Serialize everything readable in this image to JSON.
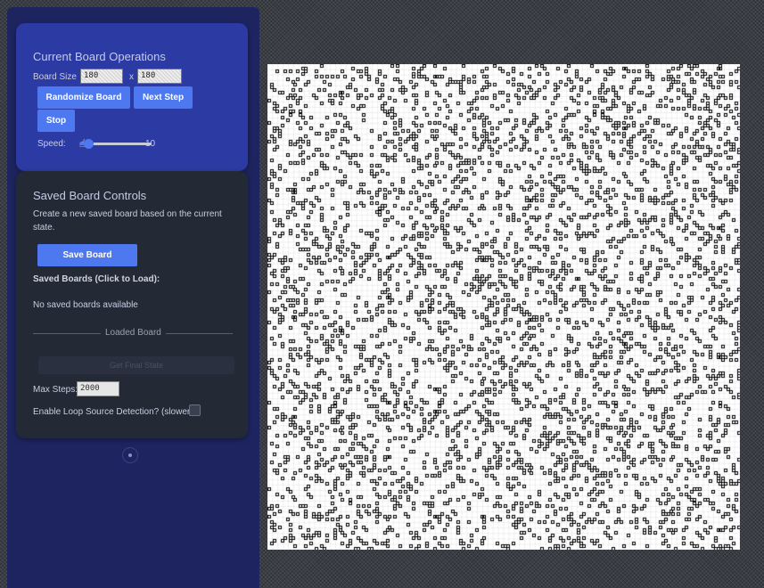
{
  "ops": {
    "title": "Current Board Operations",
    "board_size_label": "Board Size",
    "width_value": "180",
    "height_value": "180",
    "times": "x",
    "randomize_label": "Randomize Board",
    "next_step_label": "Next Step",
    "stop_label": "Stop",
    "speed_label": "Speed:",
    "speed_value": "10",
    "speed_fraction": 0.05
  },
  "saved": {
    "title": "Saved Board Controls",
    "description": "Create a new saved board based on the current state.",
    "save_label": "Save Board",
    "list_heading": "Saved Boards (Click to Load):",
    "empty_text": "No saved boards available",
    "loaded_label": "Loaded Board",
    "final_state_label": "Get Final State",
    "max_steps_label": "Max Steps:",
    "max_steps_value": "2000",
    "loop_label": "Enable Loop Source Detection? (slower)",
    "loop_checked": false
  },
  "colors": {
    "sidebar_bg": "#1e2460",
    "ops_card_bg": "#2c3aa3",
    "saved_card_bg": "#232a36",
    "button_blue": "#4d78f0",
    "live_cell": "#000000",
    "board_bg": "#ffffff"
  },
  "icons": {
    "cursor": "hand-pointer-icon",
    "spinner": "loading-spinner-icon"
  }
}
